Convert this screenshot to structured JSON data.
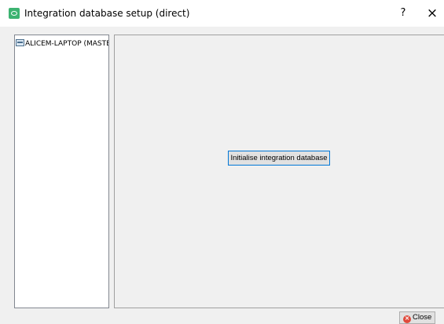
{
  "window": {
    "title": "Integration database setup (direct)",
    "help_glyph": "?",
    "close_glyph": "×"
  },
  "tree": {
    "items": [
      {
        "label": "ALICEM-LAPTOP (MASTER",
        "icon": "server-icon"
      }
    ]
  },
  "main": {
    "init_button_label": "Initialise integration database"
  },
  "footer": {
    "close_label": "Close",
    "close_icon_glyph": "✕"
  },
  "colors": {
    "accent": "#0078d7",
    "app_icon": "#3cb371",
    "close_icon": "#e04a3c"
  }
}
